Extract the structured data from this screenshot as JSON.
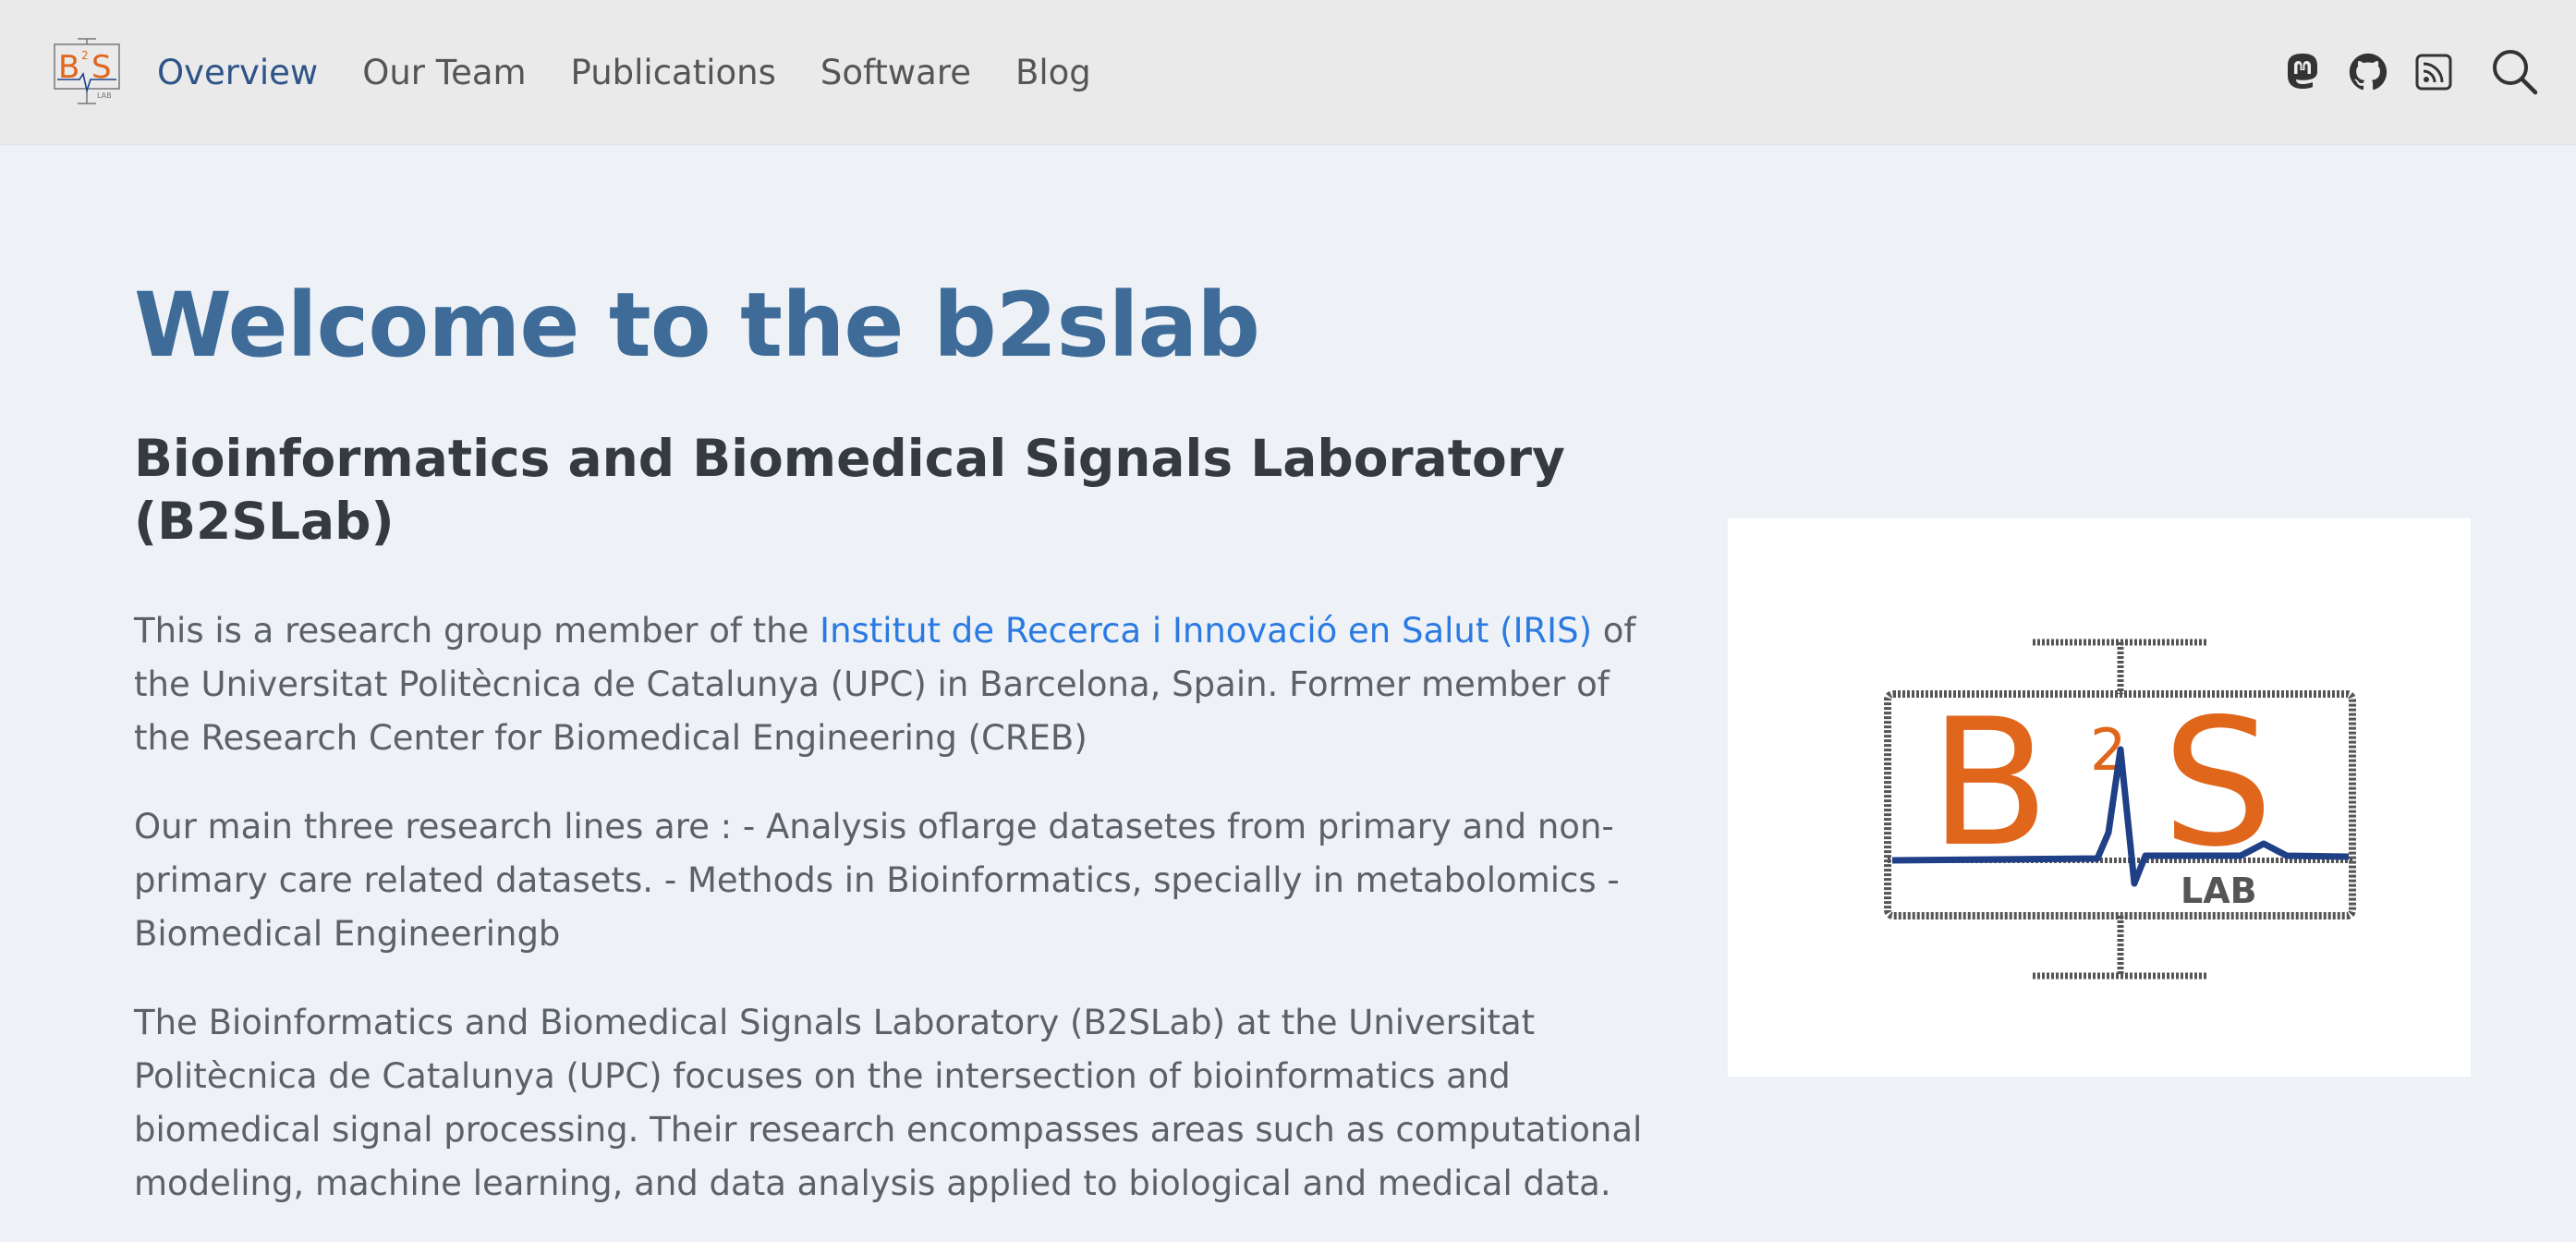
{
  "brand": {
    "logo_big": "B",
    "logo_sup": "2",
    "logo_s": "S",
    "logo_lab": "LAB"
  },
  "nav": {
    "items": [
      {
        "label": "Overview",
        "active": true
      },
      {
        "label": "Our Team",
        "active": false
      },
      {
        "label": "Publications",
        "active": false
      },
      {
        "label": "Software",
        "active": false
      },
      {
        "label": "Blog",
        "active": false
      }
    ],
    "icons": [
      "mastodon-icon",
      "github-icon",
      "rss-icon",
      "search-icon"
    ]
  },
  "main": {
    "title": "Welcome to the b2slab",
    "subtitle": "Bioinformatics and Biomedical Signals Laboratory (B2SLab)",
    "para1": {
      "before": "This is a research group member of the ",
      "link": "Institut de Recerca i Innovació en Salut (IRIS)",
      "after": " of the Universitat Politècnica de Catalunya (UPC) in Barcelona, Spain. Former member of the Research Center for Biomedical Engineering (CREB)"
    },
    "para2": "Our main three research lines are : - Analysis oflarge datasetes from primary and non-primary care related datasets. - Methods in Bioinformatics, specially in metabolomics - Biomedical Engineeringb",
    "para3": "The Bioinformatics and Biomedical Signals Laboratory (B2SLab) at the Universitat Politècnica de Catalunya (UPC) focuses on the intersection of bioinformatics and biomedical signal processing. Their research encompasses areas such as computational modeling, machine learning, and data analysis applied to biological and medical data."
  },
  "colors": {
    "navbar_bg": "#eaeaea",
    "page_bg": "#eef2f7",
    "title": "#3e6b98",
    "link": "#2a7ae2",
    "nav_active": "#2e5488",
    "logo_orange": "#e0661c",
    "logo_blue": "#1f3f86"
  }
}
